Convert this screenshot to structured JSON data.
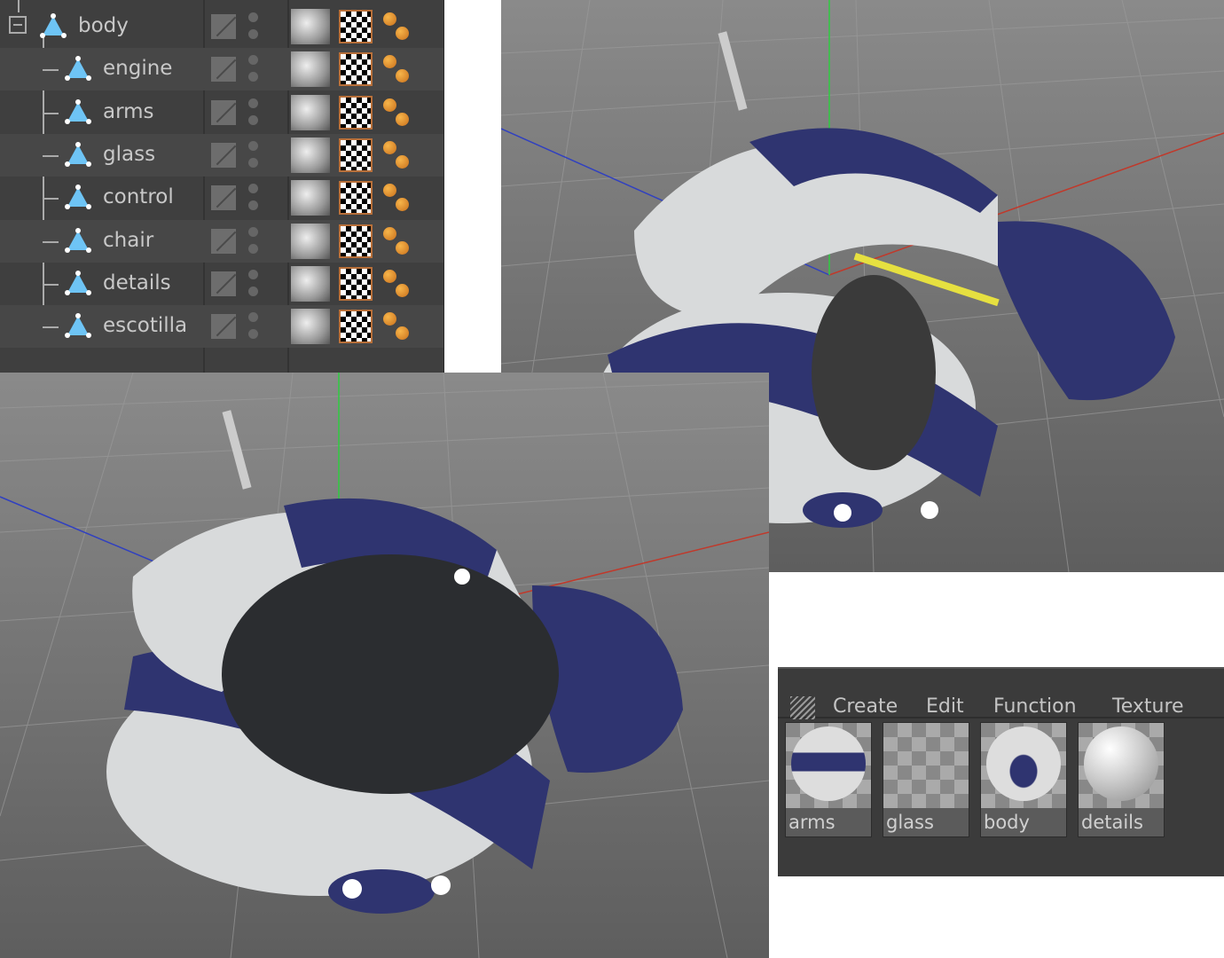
{
  "object_manager": {
    "objects": [
      {
        "name": "body",
        "level": 0
      },
      {
        "name": "engine",
        "level": 1
      },
      {
        "name": "arms",
        "level": 1
      },
      {
        "name": "glass",
        "level": 1
      },
      {
        "name": "control",
        "level": 1
      },
      {
        "name": "chair",
        "level": 1
      },
      {
        "name": "details",
        "level": 1
      },
      {
        "name": "escotilla",
        "level": 1
      }
    ]
  },
  "material_manager": {
    "menu": [
      "Create",
      "Edit",
      "Function",
      "Texture"
    ],
    "materials": [
      "arms",
      "glass",
      "body",
      "details"
    ]
  },
  "colors": {
    "robot_white": "#d8dadb",
    "robot_blue": "#2f3470",
    "axis_x": "#c0392b",
    "axis_y": "#2ecc40",
    "axis_z": "#3040c0"
  }
}
